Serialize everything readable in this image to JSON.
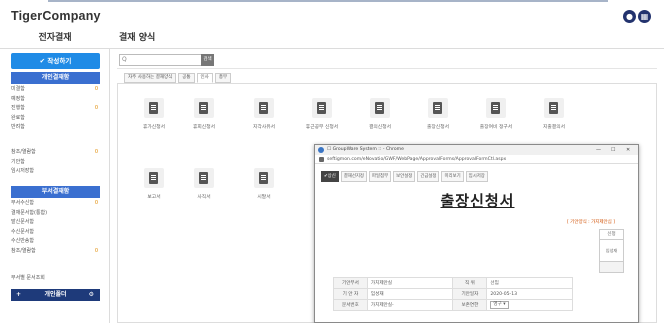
{
  "app": {
    "brand": "TigerCompany"
  },
  "header_icons": [
    "bell-icon",
    "grid-menu-icon"
  ],
  "sidebar": {
    "title": "전자결재",
    "write_button": "✔ 작성하기",
    "personal_section": "개인결재함",
    "personal_items": [
      {
        "label": "미결함",
        "count": "0"
      },
      {
        "label": "예정함",
        "count": ""
      },
      {
        "label": "진행함",
        "count": "0"
      },
      {
        "label": "완료함",
        "count": ""
      },
      {
        "label": "반려함",
        "count": ""
      }
    ],
    "personal_items2": [
      {
        "label": "참조/열람함",
        "count": "0"
      },
      {
        "label": "기안함",
        "count": ""
      },
      {
        "label": "임시저장함",
        "count": ""
      }
    ],
    "dept_section": "부서결재함",
    "dept_items": [
      {
        "label": "부서수신함",
        "count": "0"
      },
      {
        "label": "결재문서함(통합)",
        "count": ""
      },
      {
        "label": "발신문서함",
        "count": ""
      },
      {
        "label": "수신문서함",
        "count": ""
      },
      {
        "label": "수신반송함",
        "count": ""
      },
      {
        "label": "참조/열람함",
        "count": "0"
      }
    ],
    "extra_item": "부서별 문서조회",
    "folder_section": "개인폴더"
  },
  "main": {
    "title": "결재 양식",
    "search_placeholder": "Q",
    "search_button": "검색",
    "tabs": [
      "자주 사용하는 결재양식",
      "공통",
      "인사",
      "총무"
    ],
    "forms_row1": [
      "휴가신청서",
      "휴회신청서",
      "지각사유서",
      "휴근공무 신청서",
      "결의신청서",
      "출장신청서",
      "출장여비 정구서",
      "지출결의서"
    ],
    "forms_row2": [
      "보고서",
      "사직서",
      "시말서"
    ]
  },
  "popup": {
    "window_title": "☐ GroupWare System :: - Chrome",
    "url": "seftigmon.com/eNovatio/GWF/WebPage/ApprovalForms/ApprovalFormCtl.aspx",
    "window_controls": [
      "—",
      "☐",
      "✕"
    ],
    "toolbar": [
      "✔상신",
      "결재선지정",
      "파일첨부",
      "보안설정",
      "긴급설정",
      "미리보기",
      "임시저장"
    ],
    "doc_title": "출장신청서",
    "approval_caption": "[ 기안양식 : 가지제안심 ]",
    "approval_grid": {
      "header": "신청",
      "name": "임성재"
    },
    "info_rows": [
      {
        "k1": "기안부서",
        "v1": "가치제안실",
        "k2": "직 위",
        "v2": "선임"
      },
      {
        "k1": "기 안 자",
        "v1": "임성재",
        "k2": "기안일자",
        "v2": "2020-05-13"
      },
      {
        "k1": "문서번호",
        "v1": "가치제안실-",
        "k2": "보존연한",
        "v2": "영구 ▾"
      }
    ]
  }
}
